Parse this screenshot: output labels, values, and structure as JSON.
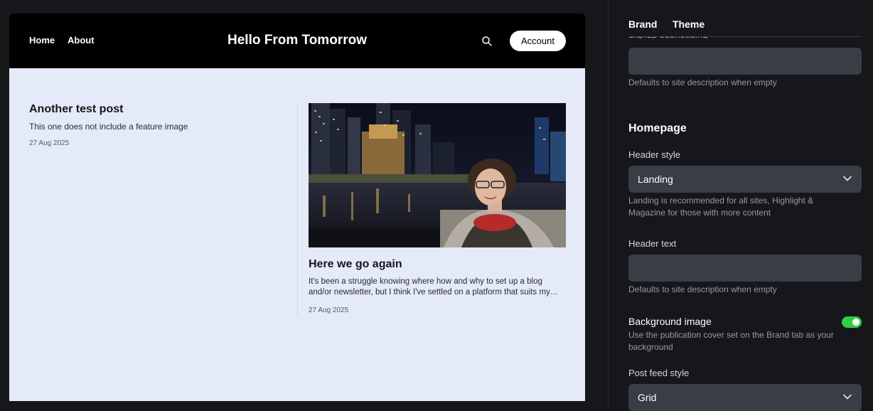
{
  "preview": {
    "nav": {
      "home": "Home",
      "about": "About"
    },
    "site_title": "Hello From Tomorrow",
    "account_label": "Account",
    "posts": [
      {
        "title": "Another test post",
        "excerpt": "This one does not include a feature image",
        "date": "27 Aug 2025"
      },
      {
        "title": "Here we go again",
        "excerpt": "It's been a struggle knowing where how and why to set up a blog and/or newsletter, but I think I've settled on a platform that suits my needs.",
        "date": "27 Aug 2025"
      }
    ]
  },
  "settings": {
    "tabs": {
      "brand": "Brand",
      "theme": "Theme"
    },
    "signup_subheading": {
      "label": "Signup subheading",
      "value": "",
      "help": "Defaults to site description when empty"
    },
    "homepage": {
      "title": "Homepage",
      "header_style": {
        "label": "Header style",
        "value": "Landing",
        "help": "Landing is recommended for all sites, Highlight & Magazine for those with more content"
      },
      "header_text": {
        "label": "Header text",
        "value": "",
        "help": "Defaults to site description when empty"
      },
      "background_image": {
        "label": "Background image",
        "help": "Use the publication cover set on the Brand tab as your background",
        "enabled": true
      },
      "post_feed_style": {
        "label": "Post feed style",
        "value": "Grid"
      }
    }
  },
  "colors": {
    "toggle_on": "#30cf43",
    "panel_bg": "#16171a",
    "preview_bg": "#e4eaf7",
    "field_bg": "#393d45"
  },
  "icons": {
    "search": "search-icon",
    "chevron": "chevron-down-icon"
  }
}
